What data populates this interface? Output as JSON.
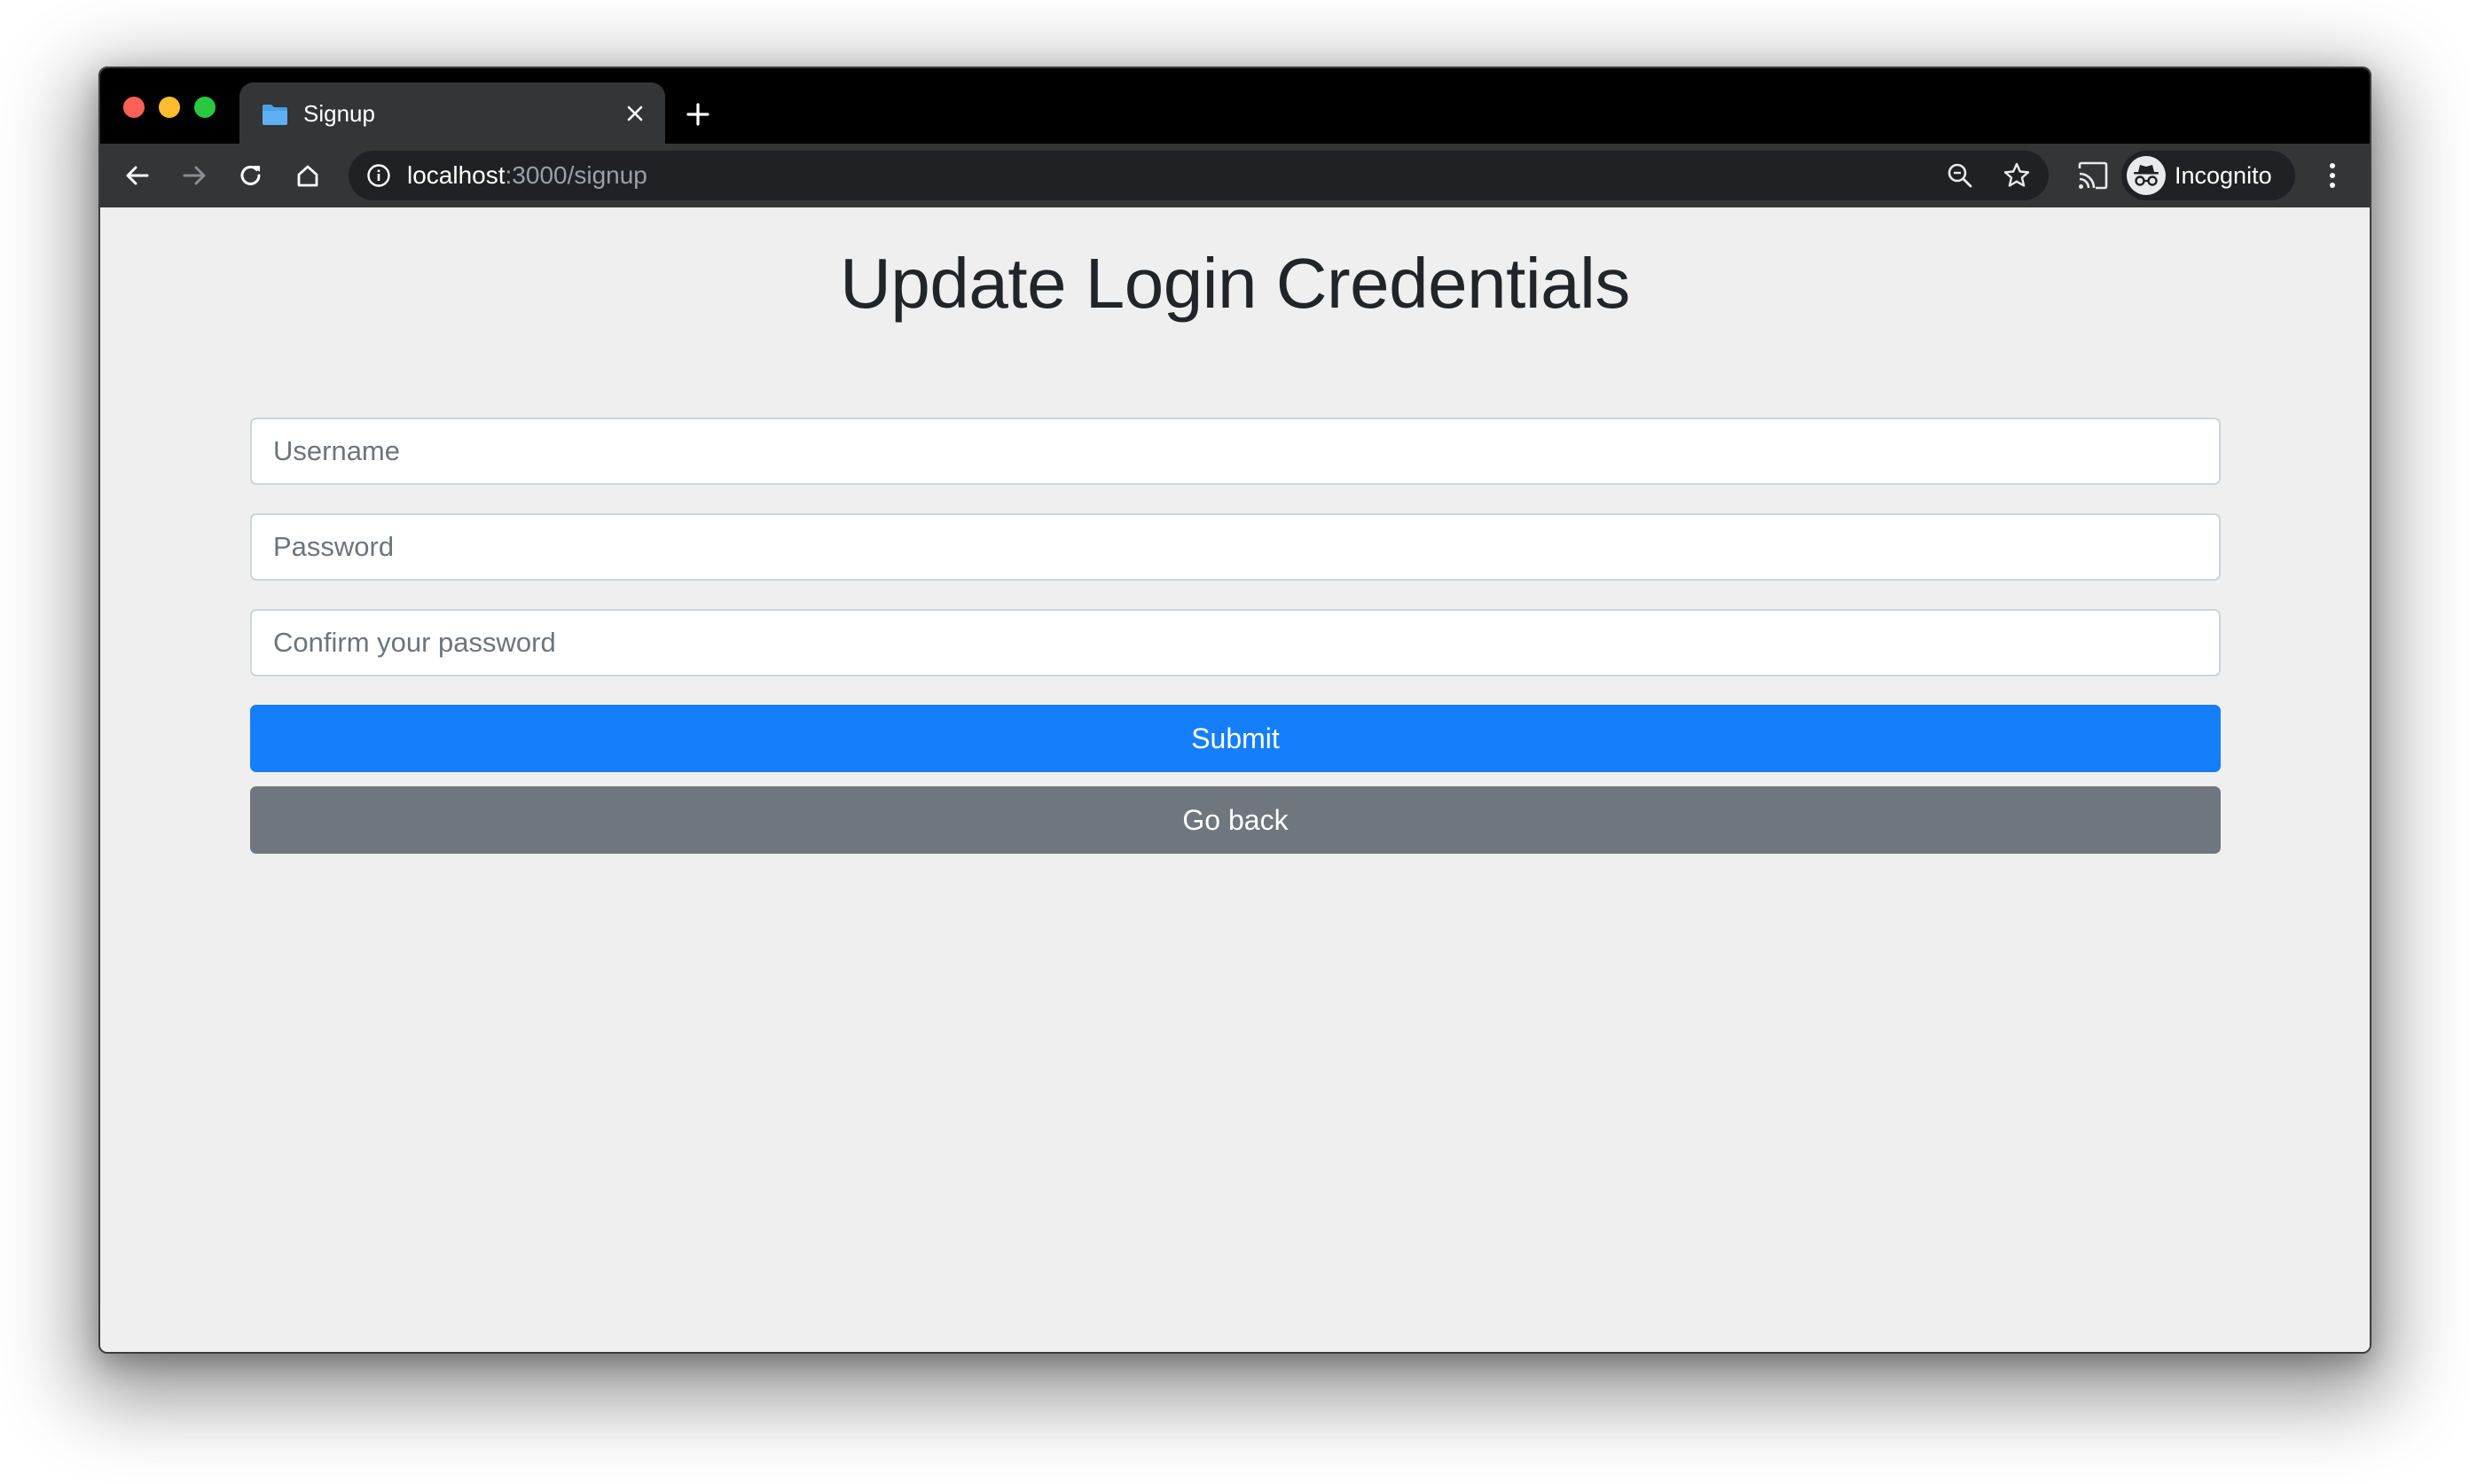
{
  "browser": {
    "tab": {
      "title": "Signup"
    },
    "address_bar": {
      "host": "localhost",
      "path": ":3000/signup"
    },
    "profile": {
      "label": "Incognito"
    }
  },
  "page": {
    "heading": "Update Login Credentials",
    "form": {
      "username": {
        "placeholder": "Username",
        "value": ""
      },
      "password": {
        "placeholder": "Password",
        "value": ""
      },
      "confirm_password": {
        "placeholder": "Confirm your password",
        "value": ""
      }
    },
    "buttons": {
      "submit": "Submit",
      "go_back": "Go back"
    }
  },
  "colors": {
    "submit_bg": "#147efb",
    "go_back_bg": "#6f767e",
    "page_bg": "#efefef",
    "heading": "#212529"
  },
  "icons": [
    "folder-icon",
    "close-icon",
    "plus-icon",
    "back-arrow-icon",
    "forward-arrow-icon",
    "reload-icon",
    "home-icon",
    "info-icon",
    "zoom-icon",
    "star-icon",
    "cast-icon",
    "incognito-icon",
    "more-vert-icon"
  ]
}
